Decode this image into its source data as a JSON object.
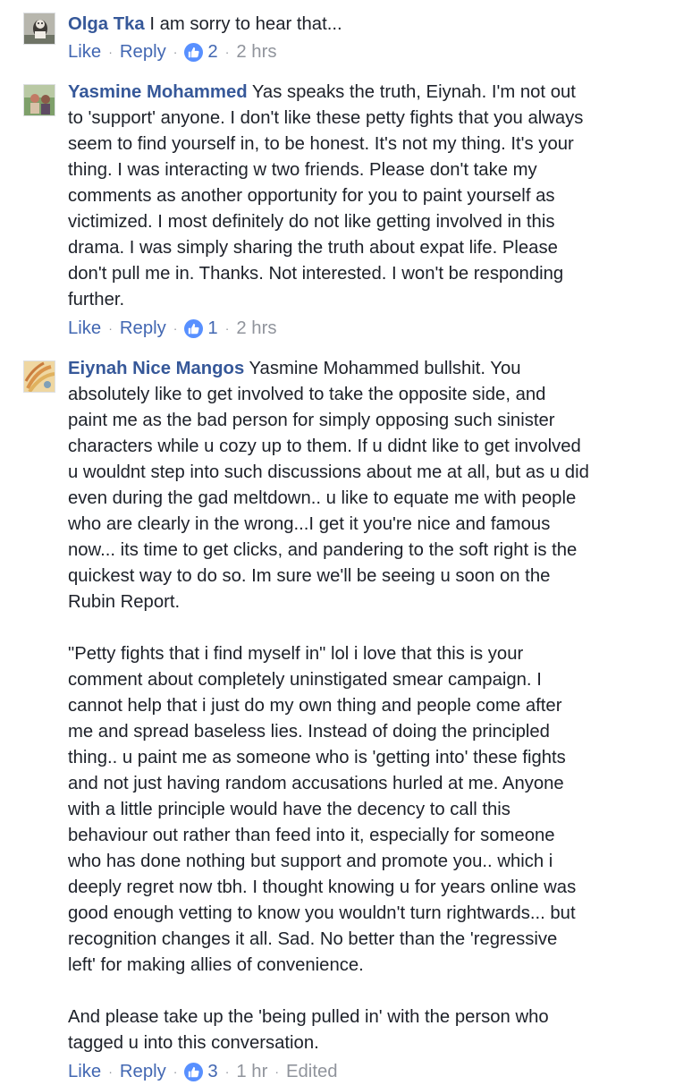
{
  "actions": {
    "like_label": "Like",
    "reply_label": "Reply",
    "separator": "·"
  },
  "comments": [
    {
      "author": "Olga Tka",
      "paragraphs": [
        "I am sorry to hear that..."
      ],
      "likes": "2",
      "time": "2 hrs"
    },
    {
      "author": "Yasmine Mohammed",
      "paragraphs": [
        [
          "Yas speaks the truth, Eiynah. I'm not out",
          "to 'support' anyone. I don't like these petty fights that you always",
          "seem to find yourself in, to be honest. It's not my thing. It's your",
          "thing. I was interacting w two friends. Please don't take my",
          "comments as another opportunity for you to paint yourself as",
          "victimized. I most definitely do not like getting involved in this",
          "drama. I was simply sharing the truth about expat life. Please",
          "don't pull me in. Thanks. Not interested. I won't be responding",
          "further."
        ]
      ],
      "likes": "1",
      "time": "2 hrs"
    },
    {
      "author": "Eiynah Nice Mangos",
      "paragraphs": [
        [
          "Yasmine Mohammed bullshit. You",
          "absolutely like to get involved to take the opposite side, and",
          "paint me as the bad person for simply opposing such sinister",
          "characters while u cozy up to them. If u didnt like to get involved",
          "u wouldnt step into such discussions about me at all, but as u did",
          "even during the gad meltdown.. u like to equate me with people",
          "who are clearly in the wrong...I get it you're nice and famous",
          "now... its time to get clicks, and pandering to the soft right is the",
          "quickest way to do so. Im sure we'll be seeing u soon on the",
          "Rubin Report."
        ],
        [
          "\"Petty fights that i find myself in\" lol i love that this is your",
          "comment about completely uninstigated smear campaign. I",
          "cannot help that i just do my own thing and people come after",
          "me and spread baseless lies. Instead of doing the principled",
          "thing.. u paint me as someone who is 'getting into' these fights",
          "and not just having random accusations hurled at me. Anyone",
          "with a little principle would have the decency to call this",
          "behaviour out rather than feed into it, especially for someone",
          "who has done nothing but support and promote you.. which i",
          "deeply regret now tbh. I thought knowing u for years online was",
          "good enough vetting to know you wouldn't turn rightwards... but",
          "recognition changes it all. Sad. No better than the 'regressive",
          "left' for making allies of convenience."
        ],
        [
          "And please take up the 'being pulled in' with the person who",
          "tagged u into this conversation."
        ]
      ],
      "likes": "3",
      "time": "1 hr",
      "edited": "Edited"
    }
  ]
}
